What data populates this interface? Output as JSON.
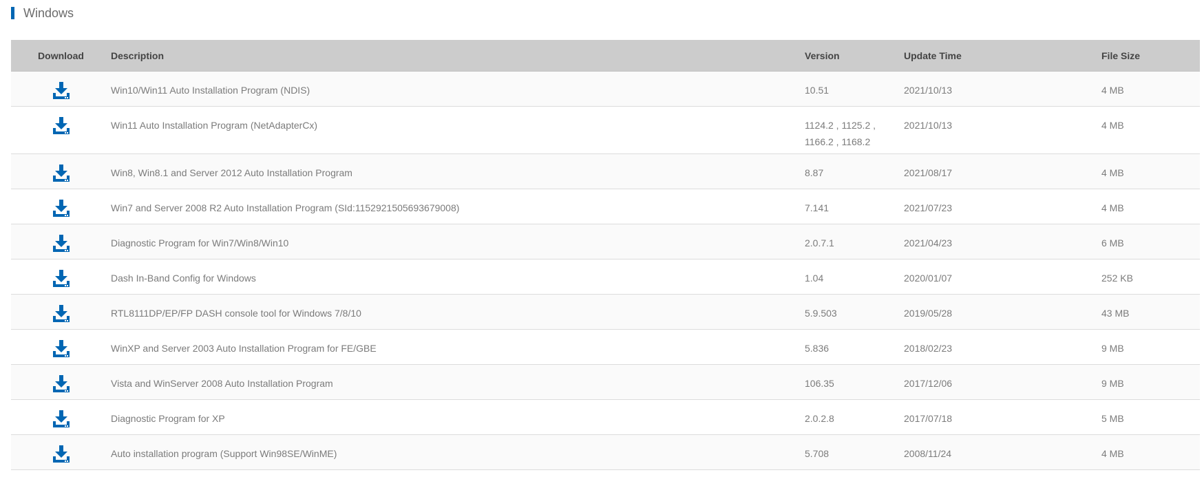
{
  "section": {
    "title": "Windows",
    "accent_color": "#0066b3"
  },
  "table": {
    "headers": {
      "download": "Download",
      "description": "Description",
      "version": "Version",
      "update_time": "Update Time",
      "file_size": "File Size"
    },
    "download_icon": "download-tray-icon",
    "rows": [
      {
        "description": "Win10/Win11 Auto Installation Program (NDIS)",
        "version": "10.51",
        "version_line2": "",
        "update_time": "2021/10/13",
        "file_size": "4 MB"
      },
      {
        "description": "Win11 Auto Installation Program (NetAdapterCx)",
        "version": "1124.2 , 1125.2 ,",
        "version_line2": "1166.2 , 1168.2",
        "update_time": "2021/10/13",
        "file_size": "4 MB"
      },
      {
        "description": "Win8, Win8.1 and Server 2012 Auto Installation Program",
        "version": "8.87",
        "version_line2": "",
        "update_time": "2021/08/17",
        "file_size": "4 MB"
      },
      {
        "description": "Win7 and Server 2008 R2 Auto Installation Program (SId:1152921505693679008)",
        "version": "7.141",
        "version_line2": "",
        "update_time": "2021/07/23",
        "file_size": "4 MB"
      },
      {
        "description": "Diagnostic Program for Win7/Win8/Win10",
        "version": "2.0.7.1",
        "version_line2": "",
        "update_time": "2021/04/23",
        "file_size": "6 MB"
      },
      {
        "description": "Dash In-Band Config for Windows",
        "version": "1.04",
        "version_line2": "",
        "update_time": "2020/01/07",
        "file_size": "252 KB"
      },
      {
        "description": "RTL8111DP/EP/FP DASH console tool for Windows 7/8/10",
        "version": "5.9.503",
        "version_line2": "",
        "update_time": "2019/05/28",
        "file_size": "43 MB"
      },
      {
        "description": "WinXP and Server 2003 Auto Installation Program for FE/GBE",
        "version": "5.836",
        "version_line2": "",
        "update_time": "2018/02/23",
        "file_size": "9 MB"
      },
      {
        "description": "Vista and WinServer 2008 Auto Installation Program",
        "version": "106.35",
        "version_line2": "",
        "update_time": "2017/12/06",
        "file_size": "9 MB"
      },
      {
        "description": "Diagnostic Program for XP",
        "version": "2.0.2.8",
        "version_line2": "",
        "update_time": "2017/07/18",
        "file_size": "5 MB"
      },
      {
        "description": "Auto installation program (Support Win98SE/WinME)",
        "version": "5.708",
        "version_line2": "",
        "update_time": "2008/11/24",
        "file_size": "4 MB"
      }
    ]
  }
}
